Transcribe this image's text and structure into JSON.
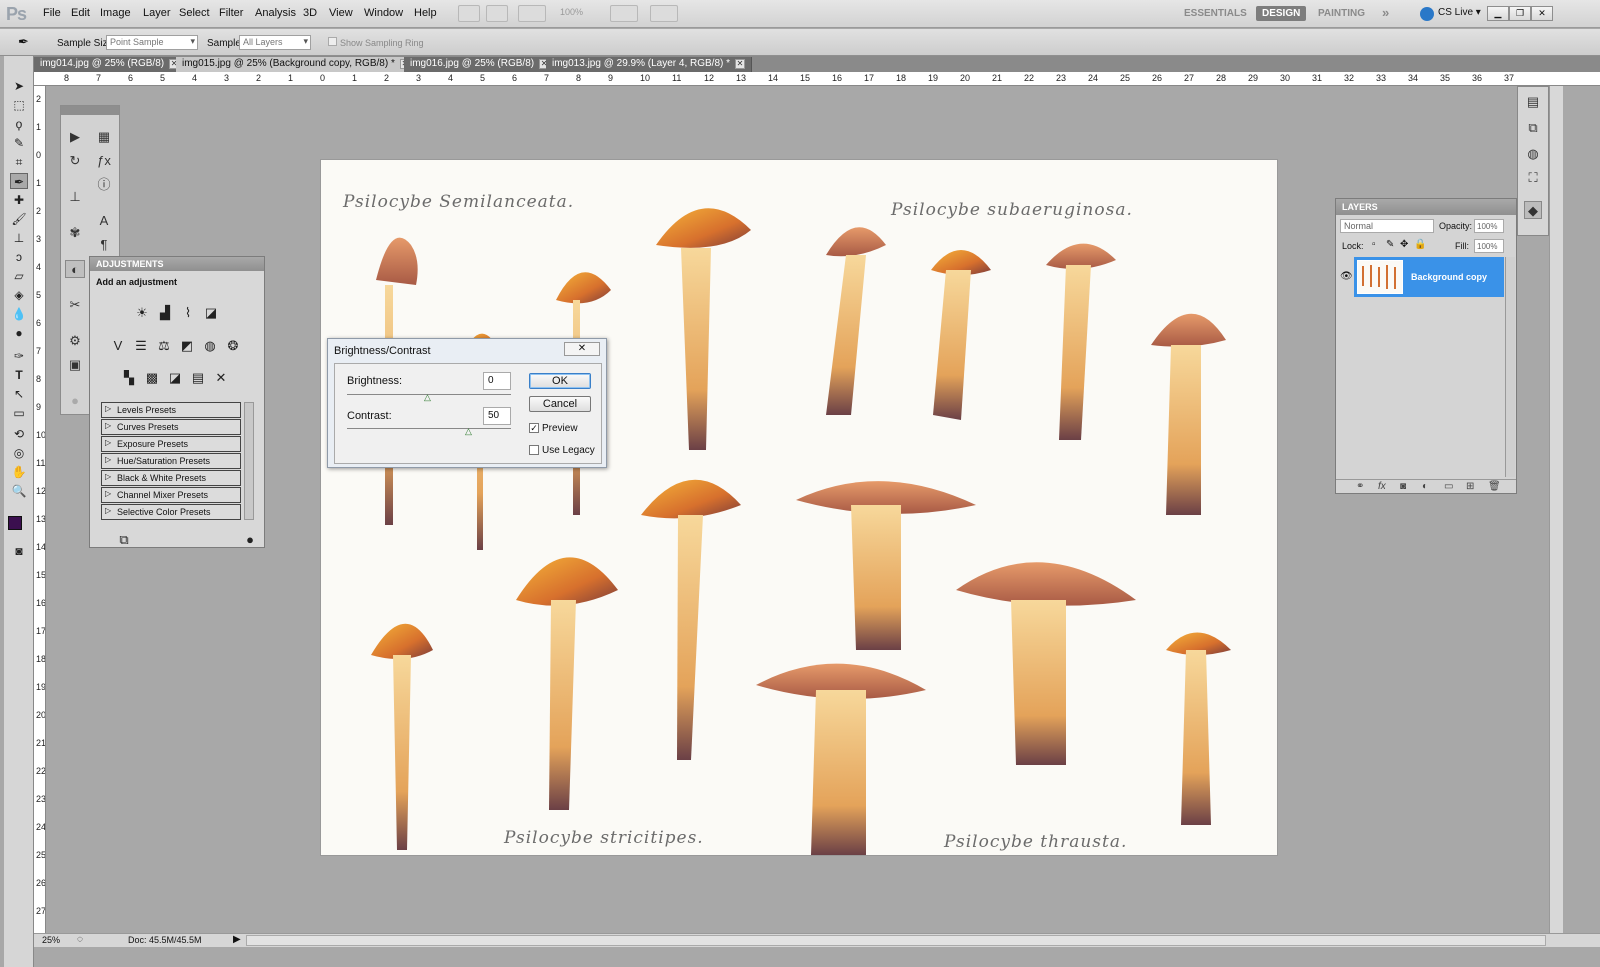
{
  "app": {
    "logo": "Ps"
  },
  "menu": [
    "File",
    "Edit",
    "Image",
    "Layer",
    "Select",
    "Filter",
    "Analysis",
    "3D",
    "View",
    "Window",
    "Help"
  ],
  "zoom_select": "100%",
  "workspaces": [
    "ESSENTIALS",
    "DESIGN",
    "PAINTING"
  ],
  "workspace_more": "»",
  "cs_live": "CS Live ▾",
  "options": {
    "sample_size_label": "Sample Size:",
    "sample_size_value": "Point Sample",
    "sample_label": "Sample:",
    "sample_value": "All Layers",
    "sampling_ring": "Show Sampling Ring"
  },
  "tabs": [
    {
      "label": "img014.jpg @ 25% (RGB/8)"
    },
    {
      "label": "img015.jpg @ 25% (Background copy, RGB/8) *"
    },
    {
      "label": "img016.jpg @ 25% (RGB/8)"
    },
    {
      "label": "img013.jpg @ 29.9% (Layer 4, RGB/8) *"
    }
  ],
  "ruler_top": [
    "8",
    "7",
    "6",
    "5",
    "4",
    "3",
    "2",
    "1",
    "0",
    "1",
    "2",
    "3",
    "4",
    "5",
    "6",
    "7",
    "8",
    "9",
    "10",
    "11",
    "12",
    "13",
    "14",
    "15",
    "16",
    "17",
    "18",
    "19",
    "20",
    "21",
    "22",
    "23",
    "24",
    "25",
    "26",
    "27",
    "28",
    "29",
    "30",
    "31",
    "32",
    "33",
    "34",
    "35",
    "36",
    "37"
  ],
  "ruler_left": [
    "2",
    "1",
    "0",
    "1",
    "2",
    "3",
    "4",
    "5",
    "6",
    "7",
    "8",
    "9",
    "10",
    "11",
    "12",
    "13",
    "14",
    "15",
    "16",
    "17",
    "18",
    "19",
    "20",
    "21",
    "22",
    "23",
    "24",
    "25",
    "26",
    "27"
  ],
  "captions": {
    "c1": "Psilocybe Semilanceata.",
    "c2": "Psilocybe subaeruginosa.",
    "c3": "Psilocybe stricitipes.",
    "c4": "Psilocybe thrausta."
  },
  "adjustments": {
    "title": "ADJUSTMENTS",
    "subtitle": "Add an adjustment",
    "presets": [
      "Levels Presets",
      "Curves Presets",
      "Exposure Presets",
      "Hue/Saturation Presets",
      "Black & White Presets",
      "Channel Mixer Presets",
      "Selective Color Presets"
    ]
  },
  "dialog": {
    "title": "Brightness/Contrast",
    "close": "✕",
    "brightness_label": "Brightness:",
    "brightness_value": "0",
    "contrast_label": "Contrast:",
    "contrast_value": "50",
    "ok": "OK",
    "cancel": "Cancel",
    "preview": "Preview",
    "preview_checked": true,
    "use_legacy": "Use Legacy",
    "use_legacy_checked": false
  },
  "layers": {
    "title": "LAYERS",
    "blend_mode": "Normal",
    "opacity_label": "Opacity:",
    "opacity_value": "100%",
    "lock_label": "Lock:",
    "fill_label": "Fill:",
    "fill_value": "100%",
    "layer_name": "Background copy"
  },
  "status": {
    "zoom": "25%",
    "doc": "Doc: 45.5M/45.5M"
  },
  "colors": {
    "foreground": "#3b0f4f",
    "background": "#000000",
    "selection": "#3a92e8"
  }
}
